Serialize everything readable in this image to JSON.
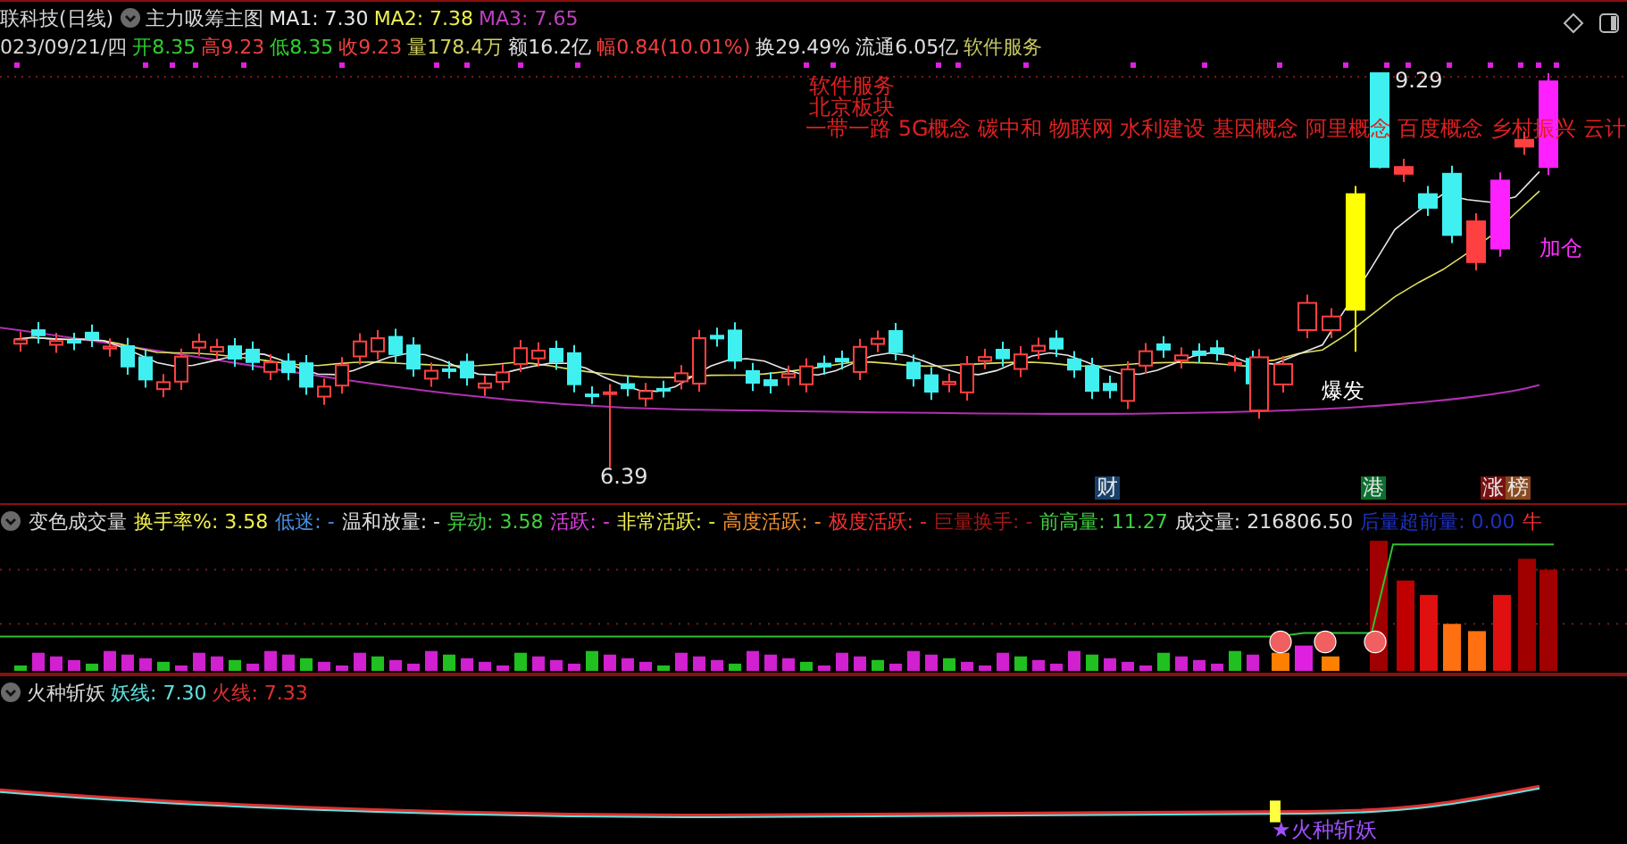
{
  "main_panel": {
    "title": "联科技(日线)",
    "indicator": "主力吸筹主图",
    "ma": [
      {
        "label": "MA1: 7.30",
        "color": "#e8e8e8"
      },
      {
        "label": "MA2: 7.38",
        "color": "#f0f050"
      },
      {
        "label": "MA3: 7.65",
        "color": "#c040c0"
      }
    ],
    "date": "023/09/21/四",
    "quote": [
      {
        "label": "开",
        "value": "8.35",
        "color": "#30d030"
      },
      {
        "label": "高",
        "value": "9.23",
        "color": "#f04040"
      },
      {
        "label": "低",
        "value": "8.35",
        "color": "#30d030"
      },
      {
        "label": "收",
        "value": "9.23",
        "color": "#f04040"
      },
      {
        "label": "量",
        "value": "178.4万",
        "color": "#d0d060"
      },
      {
        "label": "额",
        "value": "16.2亿",
        "color": "#e0e0e0"
      },
      {
        "label": "幅",
        "value": "0.84(10.01%)",
        "color": "#f04040"
      },
      {
        "label": "换",
        "value": "29.49%",
        "color": "#e0e0e0"
      },
      {
        "label": "流通",
        "value": "6.05亿",
        "color": "#e0e0e0"
      }
    ],
    "industry": "软件服务",
    "sectors": [
      "软件服务",
      "北京板块"
    ],
    "concepts": "一带一路 5G概念 碳中和 物联网 水利建设 基因概念 阿里概念 百度概念 乡村振兴 云计",
    "price_marks": [
      {
        "kind": "high",
        "text": "9.29"
      },
      {
        "kind": "low",
        "text": "6.39"
      }
    ],
    "signals": [
      {
        "kind": "burst",
        "text": "爆发",
        "color": "#ffffff"
      },
      {
        "kind": "add",
        "text": "加仓",
        "color": "#ff30ff"
      }
    ],
    "badges": [
      {
        "kind": "finance",
        "text": "财",
        "color": "#18406a"
      },
      {
        "kind": "hk",
        "text": "港",
        "color": "#0c7030"
      },
      {
        "kind": "list",
        "text": "涨",
        "color": "#7a1010"
      },
      {
        "kind": "list",
        "text": "榜",
        "color": "#8a4a20"
      }
    ]
  },
  "volume_panel": {
    "title": "变色成交量",
    "items": [
      {
        "label": "换手率%: ",
        "value": "3.58",
        "color": "#f0f050"
      },
      {
        "label": "低迷: ",
        "value": "-",
        "color": "#4a90e0"
      },
      {
        "label": "温和放量: ",
        "value": "-",
        "color": "#e0e0e0"
      },
      {
        "label": "异动: ",
        "value": "3.58",
        "color": "#40d040"
      },
      {
        "label": "活跃: ",
        "value": "-",
        "color": "#e040e0"
      },
      {
        "label": "非常活跃: ",
        "value": "-",
        "color": "#f0f050"
      },
      {
        "label": "高度活跃: ",
        "value": "-",
        "color": "#f09030"
      },
      {
        "label": "极度活跃: ",
        "value": "-",
        "color": "#f03030"
      },
      {
        "label": "巨量换手: ",
        "value": "-",
        "color": "#a01818"
      },
      {
        "label": "前高量: ",
        "value": "11.27",
        "color": "#40d040"
      },
      {
        "label": "成交量: ",
        "value": "216806.50",
        "color": "#e0e0e0"
      },
      {
        "label": "后量超前量: ",
        "value": "0.00",
        "color": "#2030c0"
      },
      {
        "label": "牛",
        "value": "",
        "color": "#f03030"
      }
    ]
  },
  "signal_panel": {
    "title": "火种斩妖",
    "items": [
      {
        "label": "妖线: ",
        "value": "7.30",
        "color": "#60e0e0"
      },
      {
        "label": "火线: ",
        "value": "7.33",
        "color": "#e03030"
      }
    ],
    "marker": "★火种斩妖"
  }
}
